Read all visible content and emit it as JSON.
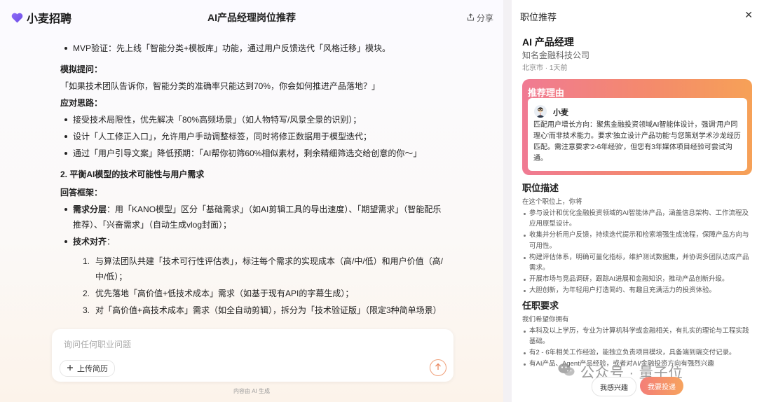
{
  "app": {
    "name": "小麦招聘"
  },
  "header": {
    "title": "AI产品经理岗位推荐",
    "share_label": "分享"
  },
  "chat": {
    "mvp": "MVP验证：先上线「智能分类+模板库」功能，通过用户反馈迭代「风格迁移」模块。",
    "mock_q_label": "模拟提问：",
    "mock_q": "「如果技术团队告诉你，智能分类的准确率只能达到70%，你会如何推进产品落地？」",
    "approach_label": "应对思路：",
    "approach": [
      "接受技术局限性，优先解决「80%高频场景」（如人物特写/风景全景的识别）；",
      "设计「人工修正入口」，允许用户手动调整标签，同时将修正数据用于模型迭代；",
      "通过「用户引导文案」降低预期：「AI帮你初筛60%相似素材，剩余精细筛选交给创意的你～」"
    ],
    "section2": "2. 平衡AI模型的技术可能性与用户需求",
    "framework_label": "回答框架：",
    "demand_label": "需求分层",
    "demand_text": "：用「KANO模型」区分「基础需求」（如AI剪辑工具的导出速度）、「期望需求」（智能配乐推荐）、「兴奋需求」（自动生成vlog封面）；",
    "align_label": "技术对齐",
    "align_colon": "：",
    "steps": [
      {
        "n": "1.",
        "text": "与算法团队共建「技术可行性评估表」，标注每个需求的实现成本（高/中/低）和用户价值（高/中/低）；"
      },
      {
        "n": "2.",
        "text": "优先落地「高价值+低技术成本」需求（如基于现有API的字幕生成）；"
      },
      {
        "n": "3.",
        "text": "对「高价值+高技术成本」需求（如全自动剪辑），拆分为「技术验证版」（限定3种简单场景）和「正式版」；"
      }
    ]
  },
  "input": {
    "placeholder": "询问任何职业问题",
    "upload_label": "上传简历"
  },
  "footnote": "内容由 AI 生成",
  "panel": {
    "title": "职位推荐",
    "job_title": "AI 产品经理",
    "company": "知名金融科技公司",
    "meta": "北京市 · 1天前",
    "rec_title": "推荐理由",
    "rec_name": "小麦",
    "rec_text": "匹配用户增长方向：聚焦金融投资领域AI智能体设计，强调'用户同理心'而非技术能力。要求'独立设计产品功能'与您策划学术沙龙经历匹配。需注意要求'2-6年经验'，但您有3年媒体项目经验可尝试沟通。",
    "desc_title": "职位描述",
    "desc_intro": "在这个职位上，你将",
    "desc_items": [
      "参与设计和优化金融投资领域的AI智能体产品，涵盖信息架构、工作流程及应用原型设计。",
      "收集并分析用户反馈，持续迭代提示和检索增强生成流程，保障产品方向与可用性。",
      "构建评估体系，明确可量化指标，维护测试数据集，并协调多团队达成产品需求。",
      "开展市场与竞品调研，跟踪AI进展和金融知识，推动产品创新升级。",
      "大胆创新，为年轻用户打造简约、有趣且充满活力的投资体验。"
    ],
    "req_title": "任职要求",
    "req_intro": "我们希望你拥有",
    "req_items": [
      "本科及以上学历，专业为计算机科学或金融相关，有扎实的理论与工程实践基础。",
      "有2 - 6年相关工作经验，能独立负责项目模块，具备端到端交付记录。",
      "有AI产品、Agent产品经验，或者对AI/金融投资方向有强烈兴趣"
    ],
    "btn_interest": "我感兴趣",
    "btn_apply": "我要投递"
  },
  "watermark": {
    "text": "公众号 · 量子位"
  },
  "colors": {
    "accent": "#f48a6c",
    "brand": "#7b5cf0"
  }
}
